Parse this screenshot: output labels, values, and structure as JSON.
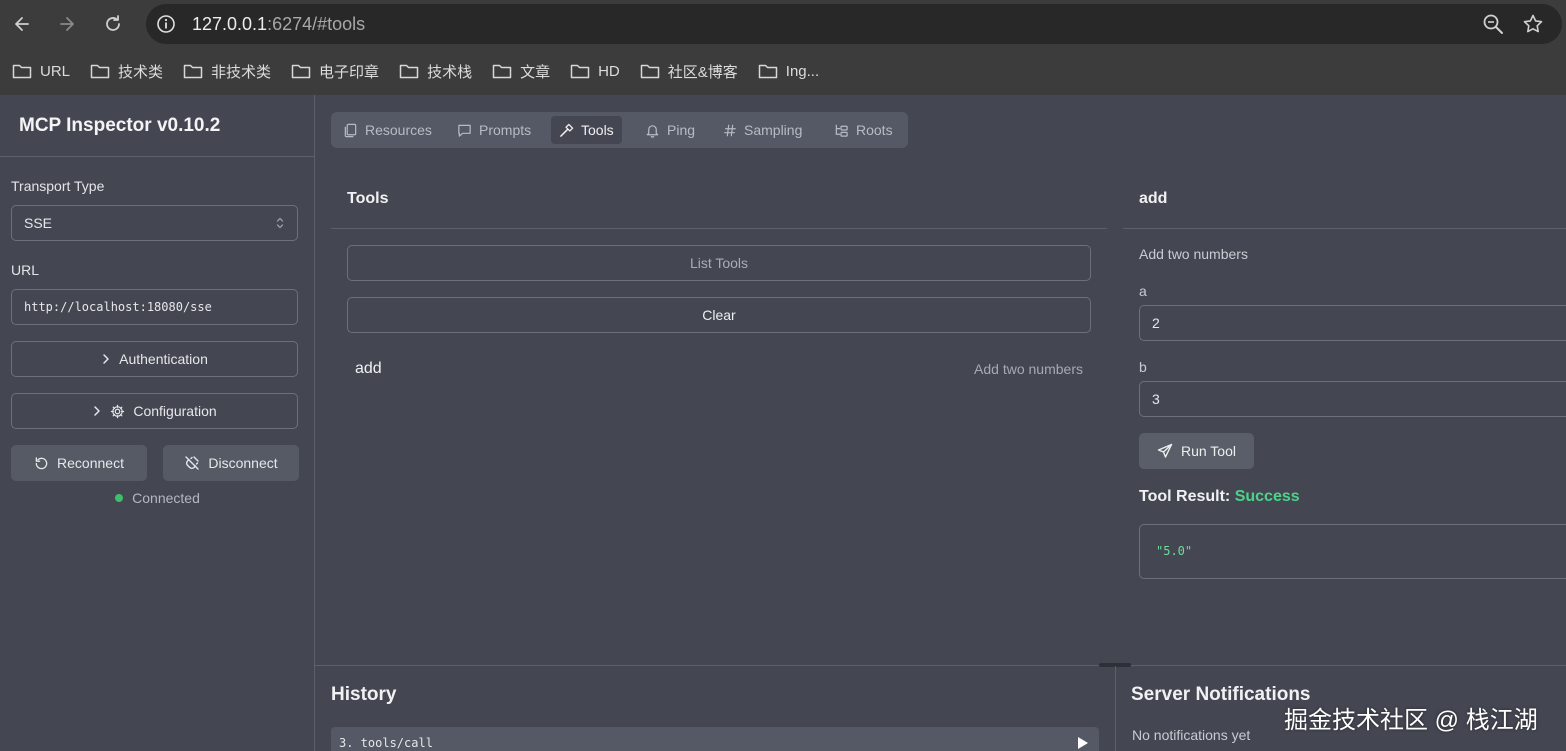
{
  "browser": {
    "url_host": "127.0.0.1",
    "url_path": ":6274/#tools",
    "bookmarks": [
      "URL",
      "技术类",
      "非技术类",
      "电子印章",
      "技术栈",
      "文章",
      "HD",
      "社区&博客",
      "Ing..."
    ]
  },
  "sidebar": {
    "title": "MCP Inspector v0.10.2",
    "transport_label": "Transport Type",
    "transport_value": "SSE",
    "url_label": "URL",
    "url_value": "http://localhost:18080/sse",
    "authentication_label": "Authentication",
    "configuration_label": "Configuration",
    "reconnect_label": "Reconnect",
    "disconnect_label": "Disconnect",
    "status_text": "Connected"
  },
  "tabs": [
    {
      "label": "Resources",
      "icon": "files-icon"
    },
    {
      "label": "Prompts",
      "icon": "message-square-icon"
    },
    {
      "label": "Tools",
      "icon": "hammer-icon",
      "active": true
    },
    {
      "label": "Ping",
      "icon": "bell-icon"
    },
    {
      "label": "Sampling",
      "icon": "hash-icon"
    },
    {
      "label": "Roots",
      "icon": "folder-tree-icon"
    }
  ],
  "tools_panel": {
    "title": "Tools",
    "list_label": "List Tools",
    "clear_label": "Clear",
    "items": [
      {
        "name": "add",
        "description": "Add two numbers"
      }
    ]
  },
  "tool_detail": {
    "title": "add",
    "description": "Add two numbers",
    "param_a_label": "a",
    "param_a_value": "2",
    "param_b_label": "b",
    "param_b_value": "3",
    "run_label": "Run Tool",
    "result_label": "Tool Result:",
    "result_status": "Success",
    "result_value": "\"5.0\""
  },
  "history": {
    "title": "History",
    "items": [
      "3. tools/call"
    ]
  },
  "notifications": {
    "title": "Server Notifications",
    "empty_text": "No notifications yet"
  },
  "watermark": "掘金技术社区 @ 栈江湖"
}
